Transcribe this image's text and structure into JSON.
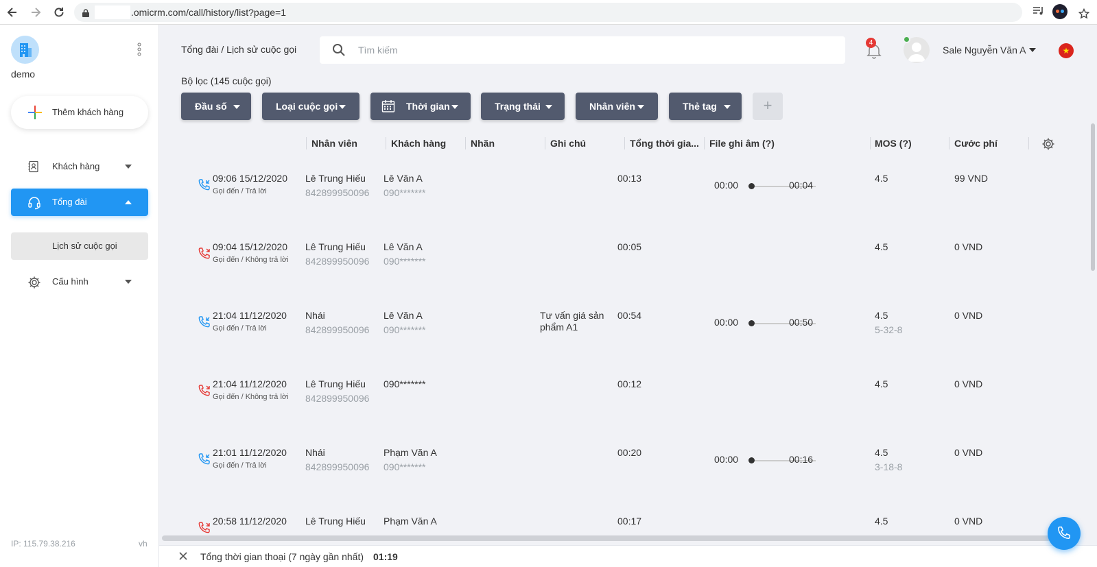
{
  "browser": {
    "url": ".omicrm.com/call/history/list?page=1"
  },
  "sidebar": {
    "org_name": "demo",
    "add_customer_label": "Thêm khách hàng",
    "items": [
      {
        "label": "Khách hàng",
        "icon": "contact-book-icon"
      },
      {
        "label": "Tổng đài",
        "icon": "headset-icon"
      },
      {
        "label": "Cấu hình",
        "icon": "gear-icon"
      }
    ],
    "sub_item_label": "Lịch sử cuộc gọi",
    "ip": "IP: 115.79.38.216",
    "lang": "vh"
  },
  "header": {
    "breadcrumb": "Tổng đài / Lịch sử cuộc gọi",
    "search_placeholder": "Tìm kiếm",
    "notification_count": "4",
    "user_name": "Sale Nguyễn Văn A"
  },
  "filters": {
    "title": "Bộ lọc (145 cuộc gọi)",
    "buttons": [
      "Đầu số",
      "Loại cuộc gọi",
      "Thời gian",
      "Trạng thái",
      "Nhân viên",
      "Thẻ tag"
    ],
    "add_label": "+"
  },
  "table": {
    "columns": [
      "Nhân viên",
      "Khách hàng",
      "Nhãn",
      "Ghi chú",
      "Tổng thời gia...",
      "File ghi âm (?)",
      "MOS (?)",
      "Cước phí"
    ],
    "rows": [
      {
        "time": "09:06 15/12/2020",
        "status": "Gọi đến / Trả lời",
        "answered": true,
        "agent": "Lê Trung Hiếu",
        "agent_phone": "842899950096",
        "customer": "Lê Văn A",
        "customer_phone": "090*******",
        "label": "",
        "note": "",
        "duration": "00:13",
        "rec_start": "00:00",
        "rec_end": "00:04",
        "mos": "4.5",
        "mos_sub": "",
        "fee": "99 VND"
      },
      {
        "time": "09:04 15/12/2020",
        "status": "Gọi đến / Không trả lời",
        "answered": false,
        "agent": "Lê Trung Hiếu",
        "agent_phone": "842899950096",
        "customer": "Lê Văn A",
        "customer_phone": "090*******",
        "label": "",
        "note": "",
        "duration": "00:05",
        "rec_start": "",
        "rec_end": "",
        "mos": "4.5",
        "mos_sub": "",
        "fee": "0 VND"
      },
      {
        "time": "21:04 11/12/2020",
        "status": "Gọi đến / Trả lời",
        "answered": true,
        "agent": "Nhái",
        "agent_phone": "842899950096",
        "customer": "Lê Văn A",
        "customer_phone": "090*******",
        "label": "",
        "note": "Tư vấn giá sản phẩm A1",
        "duration": "00:54",
        "rec_start": "00:00",
        "rec_end": "00:50",
        "mos": "4.5",
        "mos_sub": "5-32-8",
        "fee": "0 VND"
      },
      {
        "time": "21:04 11/12/2020",
        "status": "Gọi đến / Không trả lời",
        "answered": false,
        "agent": "Lê Trung Hiếu",
        "agent_phone": "842899950096",
        "customer": "090*******",
        "customer_phone": "",
        "label": "",
        "note": "",
        "duration": "00:12",
        "rec_start": "",
        "rec_end": "",
        "mos": "4.5",
        "mos_sub": "",
        "fee": "0 VND"
      },
      {
        "time": "21:01 11/12/2020",
        "status": "Gọi đến / Trả lời",
        "answered": true,
        "agent": "Nhái",
        "agent_phone": "842899950096",
        "customer": "Phạm Văn A",
        "customer_phone": "090*******",
        "label": "",
        "note": "",
        "duration": "00:20",
        "rec_start": "00:00",
        "rec_end": "00:16",
        "mos": "4.5",
        "mos_sub": "3-18-8",
        "fee": "0 VND"
      },
      {
        "time": "20:58 11/12/2020",
        "status": "",
        "answered": false,
        "agent": "Lê Trung Hiếu",
        "agent_phone": "",
        "customer": "Phạm Văn A",
        "customer_phone": "",
        "label": "",
        "note": "",
        "duration": "00:17",
        "rec_start": "",
        "rec_end": "",
        "mos": "4.5",
        "mos_sub": "",
        "fee": "0 VND"
      }
    ]
  },
  "footer": {
    "label": "Tổng thời gian thoại (7 ngày gần nhất)",
    "value": "01:19"
  },
  "colors": {
    "primary": "#2196f3",
    "filter_button": "#525a6e",
    "answered_icon": "#2196f3",
    "missed_icon": "#e53935"
  }
}
